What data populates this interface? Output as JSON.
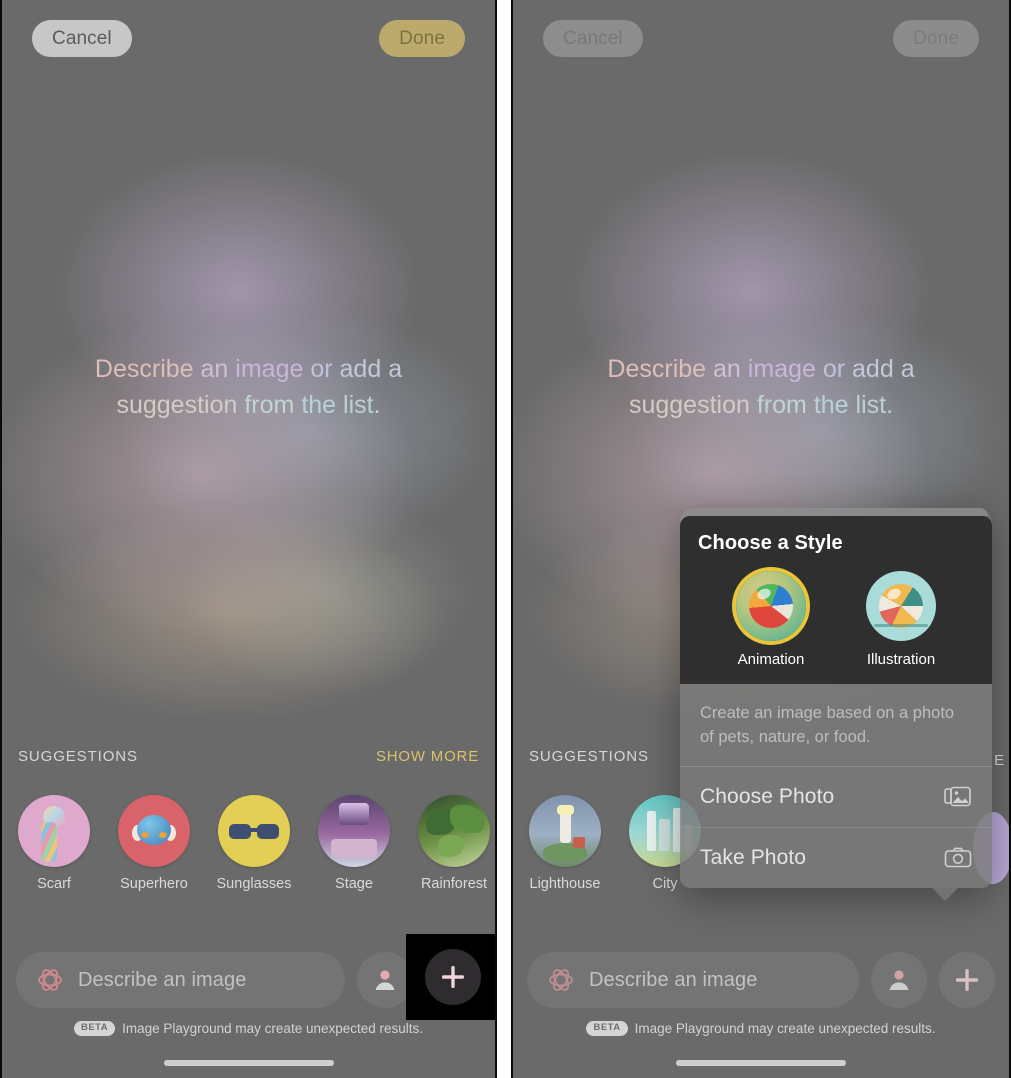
{
  "screens": [
    {
      "id": "left",
      "topbar": {
        "cancel": "Cancel",
        "done": "Done"
      },
      "hero_words": [
        {
          "t": "Describe",
          "c": "h1"
        },
        {
          "t": "an",
          "c": "h2"
        },
        {
          "t": "image",
          "c": "h3"
        },
        {
          "t": "or",
          "c": "h4"
        },
        {
          "t": "add",
          "c": "h5"
        },
        {
          "t": "a",
          "c": "h5"
        },
        {
          "t": "suggestion",
          "c": "h6"
        },
        {
          "t": "from",
          "c": "h7"
        },
        {
          "t": "the",
          "c": "h8"
        },
        {
          "t": "list.",
          "c": "h9"
        }
      ],
      "suggestions_header": {
        "title": "SUGGESTIONS",
        "action": "SHOW MORE"
      },
      "suggestions": [
        {
          "label": "Scarf",
          "art": "art-scarf"
        },
        {
          "label": "Superhero",
          "art": "art-superhero"
        },
        {
          "label": "Sunglasses",
          "art": "art-sunglass"
        },
        {
          "label": "Stage",
          "art": "art-stage"
        },
        {
          "label": "Rainforest",
          "art": "art-rainfor"
        }
      ],
      "input": {
        "placeholder": "Describe an image",
        "value": ""
      },
      "disclaimer": {
        "badge": "BETA",
        "text": "Image Playground may create unexpected results."
      }
    },
    {
      "id": "right",
      "topbar": {
        "cancel": "Cancel",
        "done": "Done"
      },
      "hero_words": [
        {
          "t": "Describe",
          "c": "h1"
        },
        {
          "t": "an",
          "c": "h2"
        },
        {
          "t": "image",
          "c": "h3"
        },
        {
          "t": "or",
          "c": "h4"
        },
        {
          "t": "add",
          "c": "h5"
        },
        {
          "t": "a",
          "c": "h5"
        },
        {
          "t": "suggestion",
          "c": "h6"
        },
        {
          "t": "from",
          "c": "h7"
        },
        {
          "t": "the",
          "c": "h8"
        },
        {
          "t": "list.",
          "c": "h9"
        }
      ],
      "suggestions_header": {
        "title": "SUGGESTIONS",
        "action": ""
      },
      "suggestions": [
        {
          "label": "Lighthouse",
          "art": "art-lighthouse"
        },
        {
          "label": "City",
          "art": "art-city"
        }
      ],
      "edge_letter": "E",
      "input": {
        "placeholder": "Describe an image",
        "value": ""
      },
      "disclaimer": {
        "badge": "BETA",
        "text": "Image Playground may create unexpected results."
      }
    }
  ],
  "popup": {
    "title": "Choose a Style",
    "styles": [
      {
        "label": "Animation",
        "selected": true,
        "ring_color": "#e8c53b"
      },
      {
        "label": "Illustration",
        "selected": false,
        "ring_color": ""
      }
    ],
    "description": "Create an image based on a photo of pets, nature, or food.",
    "items": [
      {
        "label": "Choose Photo",
        "icon": "photos-icon"
      },
      {
        "label": "Take Photo",
        "icon": "camera-icon"
      }
    ]
  },
  "colors": {
    "accent_done": "#ceb86e",
    "accent_show_more": "#d8c26a",
    "selection_ring": "#e8c53b",
    "panel_background": "#6a6a6a",
    "popup_dark": "#2f2f2f",
    "highlight_box": "#000000"
  }
}
